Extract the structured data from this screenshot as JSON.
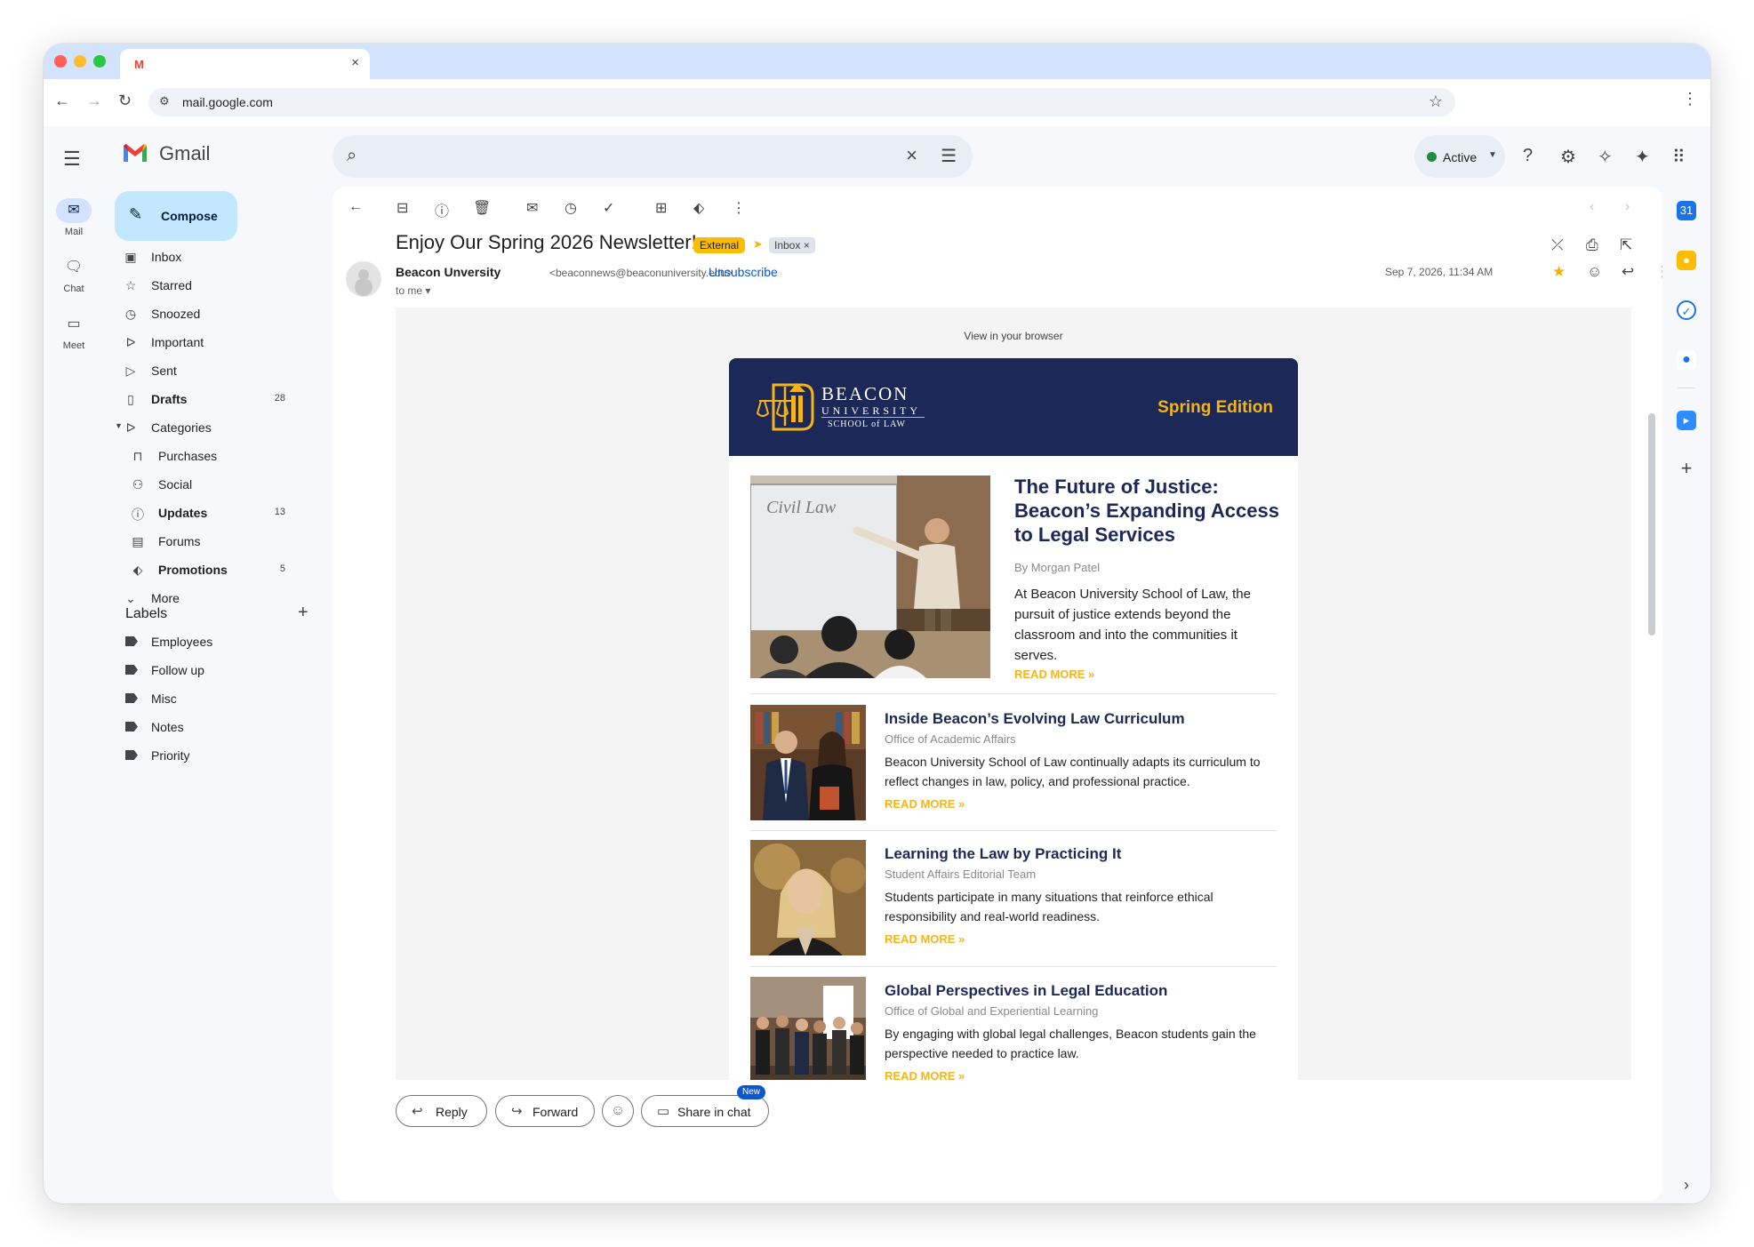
{
  "browser": {
    "tab_close": "×",
    "favicon": "M",
    "url": "mail.google.com"
  },
  "gmail": {
    "app_name": "Gmail",
    "compose_label": "Compose",
    "rail": [
      {
        "label": "Mail"
      },
      {
        "label": "Chat"
      },
      {
        "label": "Meet"
      }
    ],
    "nav": [
      {
        "label": "Inbox",
        "count": "",
        "icon": "inbox-icon"
      },
      {
        "label": "Starred",
        "count": "",
        "icon": "star-icon"
      },
      {
        "label": "Snoozed",
        "count": "",
        "icon": "clock-icon"
      },
      {
        "label": "Important",
        "count": "",
        "icon": "important-icon"
      },
      {
        "label": "Sent",
        "count": "",
        "icon": "send-icon"
      },
      {
        "label": "Drafts",
        "count": "28",
        "icon": "draft-icon"
      },
      {
        "label": "Categories",
        "count": "",
        "icon": "label-icon"
      },
      {
        "label": "Purchases",
        "count": "",
        "icon": "shopping-bag-icon"
      },
      {
        "label": "Social",
        "count": "",
        "icon": "people-icon"
      },
      {
        "label": "Updates",
        "count": "13",
        "icon": "info-icon"
      },
      {
        "label": "Forums",
        "count": "",
        "icon": "forum-icon"
      },
      {
        "label": "Promotions",
        "count": "5",
        "icon": "tag-icon"
      },
      {
        "label": "More",
        "count": "",
        "icon": "chevron-down-icon"
      }
    ],
    "labels_heading": "Labels",
    "labels": [
      "Employees",
      "Follow up",
      "Misc",
      "Notes",
      "Priority"
    ],
    "status": "Active"
  },
  "email": {
    "subject": "Enjoy Our Spring 2026 Newsletter!",
    "badge_external": "External",
    "badge_inbox": "Inbox ×",
    "sender_name": "Beacon Unversity",
    "sender_email": "<beaconnews@beaconuniversity.edu>",
    "unsubscribe": "Unsubscribe",
    "to": "to me",
    "date": "Sep 7, 2026, 11:34 AM",
    "reply_label": "Reply",
    "forward_label": "Forward",
    "share_label": "Share in chat",
    "new_badge": "New"
  },
  "newsletter": {
    "view_in_browser": "View in your browser",
    "logo_line1": "BEACON",
    "logo_line2": "UNIVERSITY",
    "logo_line3": "SCHOOL of LAW",
    "edition": "Spring Edition",
    "feature": {
      "title": "The Future of Justice: Beacon’s Expanding Access to Legal Services",
      "byline": "By Morgan Patel",
      "text": "At Beacon University School of Law, the pursuit of justice extends beyond the classroom and into the communities it serves.",
      "read_more": "READ MORE »",
      "whiteboard_text": "Civil Law"
    },
    "articles": [
      {
        "title": "Inside Beacon’s Evolving Law Curriculum",
        "byline": "Office of Academic Affairs",
        "text": "Beacon University School of Law continually adapts its curriculum to reflect changes in law, policy, and professional practice.",
        "read_more": "READ MORE »"
      },
      {
        "title": "Learning the Law by Practicing It",
        "byline": "Student Affairs Editorial Team",
        "text": "Students participate in many situations that reinforce ethical responsibility and real-world readiness.",
        "read_more": "READ MORE »"
      },
      {
        "title": "Global Perspectives in Legal Education",
        "byline": "Office of Global and Experiential Learning",
        "text": "By engaging with global legal challenges, Beacon students gain the perspective needed to practice law.",
        "read_more": "READ MORE »"
      }
    ]
  },
  "colors": {
    "navy": "#1c2857",
    "gold": "#f3b51a",
    "accent_blue": "#0b57d0"
  }
}
